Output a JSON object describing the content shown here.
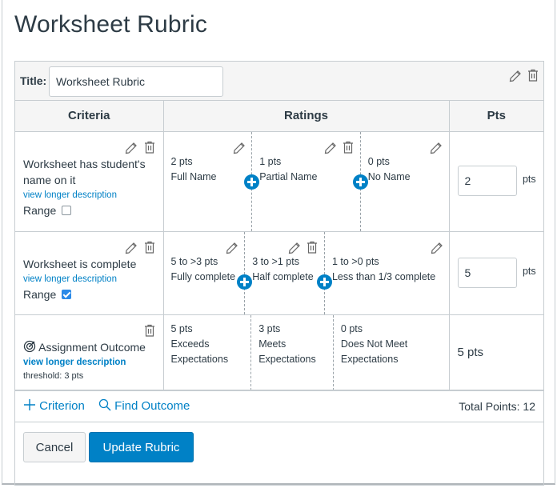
{
  "page_title": "Worksheet Rubric",
  "rubric": {
    "title_label": "Title:",
    "title_value": "Worksheet Rubric",
    "headers": {
      "criteria": "Criteria",
      "ratings": "Ratings",
      "pts": "Pts"
    },
    "criteria": [
      {
        "description": "Worksheet has student's name on it",
        "long_desc_link": "view longer description",
        "range_label": "Range",
        "range_checked": false,
        "points": "2",
        "pts_suffix": "pts",
        "ratings": [
          {
            "points": "2 pts",
            "label": "Full Name"
          },
          {
            "points": "1 pts",
            "label": "Partial Name"
          },
          {
            "points": "0 pts",
            "label": "No Name"
          }
        ]
      },
      {
        "description": "Worksheet is complete",
        "long_desc_link": "view longer description",
        "range_label": "Range",
        "range_checked": true,
        "points": "5",
        "pts_suffix": "pts",
        "ratings": [
          {
            "points": "5 to >3 pts",
            "label": "Fully complete"
          },
          {
            "points": "3 to >1 pts",
            "label": "Half complete"
          },
          {
            "points": "1 to >0 pts",
            "label": "Less than 1/3 complete"
          }
        ]
      }
    ],
    "outcome": {
      "icon": "outcome-target-icon",
      "title": "Assignment Outcome",
      "long_desc_link": "view longer description",
      "threshold": "threshold: 3 pts",
      "points": "5 pts",
      "ratings": [
        {
          "points": "5 pts",
          "label": "Exceeds Expectations"
        },
        {
          "points": "3 pts",
          "label": "Meets Expectations"
        },
        {
          "points": "0 pts",
          "label": "Does Not Meet Expectations"
        }
      ]
    },
    "footer": {
      "add_criterion": "Criterion",
      "find_outcome": "Find Outcome",
      "total_points": "Total Points: 12"
    }
  },
  "buttons": {
    "cancel": "Cancel",
    "update": "Update Rubric"
  },
  "colors": {
    "accent": "#0081c6",
    "checkbox": "#2b8ae8",
    "text": "#2d3b45",
    "border": "#c7cdd1",
    "header_bg": "#f5f5f5"
  }
}
